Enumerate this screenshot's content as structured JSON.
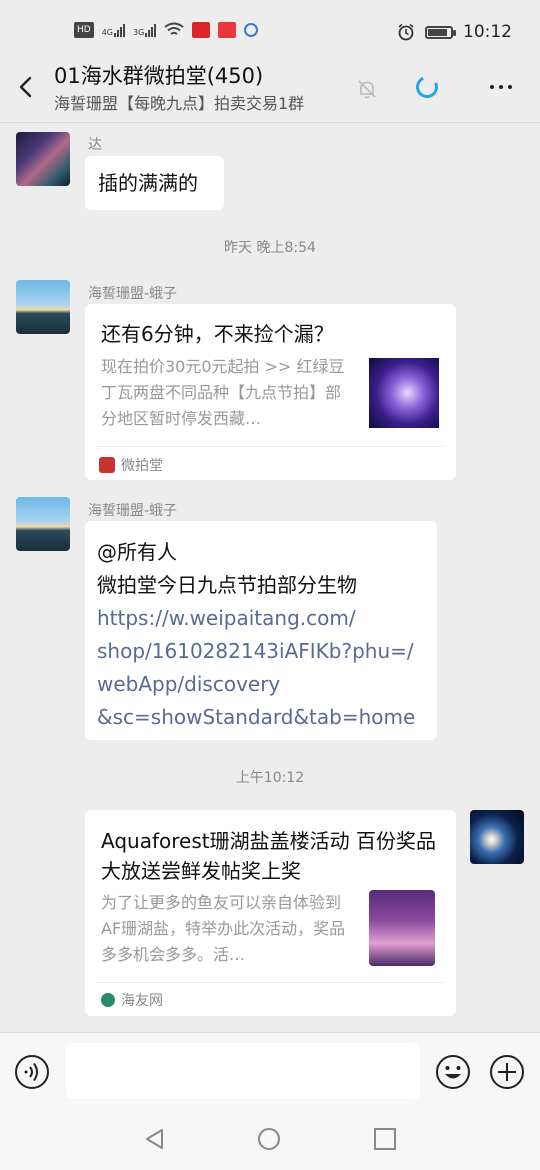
{
  "status_bar": {
    "left_badges": [
      "HD",
      "4G",
      "3G"
    ],
    "time": "10:12",
    "battery_level": 0.85
  },
  "header": {
    "title": "01海水群微拍堂(450)",
    "subtitle": "海誓珊盟【每晚九点】拍卖交易1群",
    "icons": [
      "back-arrow-icon",
      "mute-bell-icon",
      "refresh-icon",
      "more-icon"
    ]
  },
  "messages": [
    {
      "type": "text",
      "sender": "达",
      "text": "插的满满的"
    },
    {
      "type": "time",
      "text": "昨天 晚上8:54"
    },
    {
      "type": "card",
      "sender": "海誓珊盟-蛾子",
      "title": "还有6分钟，不来捡个漏？",
      "desc": "现在拍价30元0元起拍 >> 红绿豆丁瓦两盘不同品种【九点节拍】部分地区暂时停发西藏…",
      "source": "微拍堂"
    },
    {
      "type": "text",
      "sender": "海誓珊盟-蛾子",
      "lines": [
        "@所有人",
        "微拍堂今日九点节拍部分生物"
      ],
      "link_lines": [
        "https://w.weipaitang.com/",
        "shop/1610282143iAFIKb?phu=/",
        "webApp/discovery",
        "&sc=showStandard&tab=home"
      ]
    },
    {
      "type": "time",
      "text": "上午10:12"
    },
    {
      "type": "card",
      "sender": "self",
      "title": "Aquaforest珊湖盐盖楼活动 百份奖品大放送尝鲜发帖奖上奖",
      "desc": "为了让更多的鱼友可以亲自体验到AF珊湖盐，特举办此次活动，奖品多多机会多多。活…",
      "source": "海友网"
    }
  ],
  "colors": {
    "link": "#576b95",
    "background": "#ededed",
    "bubble": "#ffffff",
    "accent": "#1ea7e8"
  }
}
